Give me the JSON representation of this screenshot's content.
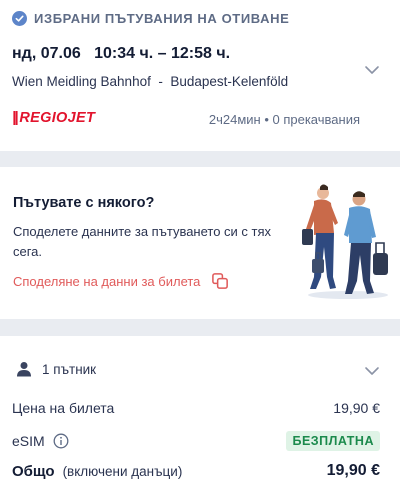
{
  "trip": {
    "header_label": "ИЗБРАНИ ПЪТУВАНИЯ НА ОТИВАНЕ",
    "date_time": "нд, 07.06   10:34 ч. – 12:58 ч.",
    "stations": "Wien Meidling Bahnhof  -  Budapest-Kelenföld",
    "carrier_bars": "||",
    "carrier_name": "REGIOJET",
    "duration": "2ч24мин • 0 прекачвания",
    "colors": {
      "accent": "#5d85c9",
      "carrier": "#e2142d"
    }
  },
  "share": {
    "title": "Пътувате с някого?",
    "text": "Споделете данните за пътуването си с тях сега.",
    "link_label": "Споделяне на данни за билета",
    "link_color": "#e05a5a"
  },
  "price": {
    "passengers": "1 пътник",
    "ticket_label": "Цена на билета",
    "ticket_value": "19,90 €",
    "esim_label": "eSIM",
    "esim_value": "БЕЗПЛАТНА",
    "total_label": "Общо",
    "total_sub": "(включени данъци)",
    "total_value": "19,90 €",
    "free_color": "#1b8a4c"
  },
  "icons": [
    "check-circle-icon",
    "chevron-down-icon",
    "copy-icon",
    "person-icon",
    "info-icon"
  ]
}
